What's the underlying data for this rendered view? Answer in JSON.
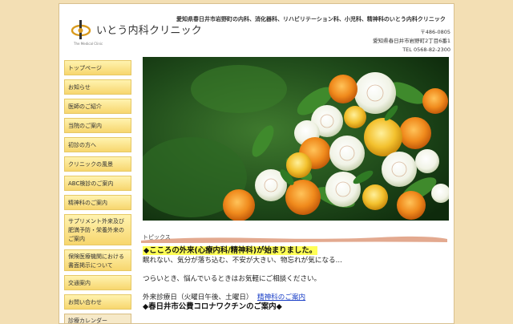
{
  "header": {
    "logo_name": "いとう内科クリニック",
    "logo_tagline_small": "The Medical Clinic",
    "tagline": "愛知県春日井市岩野町の内科、消化器科、リハビリテーション科、小児科、精神科のいとう内科クリニック",
    "postal": "〒486-0805",
    "address": "愛知県春日井市岩野町2丁目6番1",
    "tel": "TEL 0568-82-2300"
  },
  "sidebar": {
    "items": [
      {
        "label": "トップページ"
      },
      {
        "label": "お知らせ"
      },
      {
        "label": "医師のご紹介"
      },
      {
        "label": "当院のご案内"
      },
      {
        "label": "初診の方へ"
      },
      {
        "label": "クリニックの風景"
      },
      {
        "label": "ABC検診のご案内"
      },
      {
        "label": "精神科のご案内"
      },
      {
        "label": "サプリメント外来及び肥満予防・栄養外来のご案内"
      },
      {
        "label": "保険医療機関における書面掲示について"
      },
      {
        "label": "交通案内"
      },
      {
        "label": "お問い合わせ"
      }
    ],
    "calendar_label": "診療カレンダー"
  },
  "topics": {
    "label": "トピックス"
  },
  "content": {
    "headline1": "◆こころの外来(心療内科/精神科)が始まりました。",
    "line1": "眠れない、気分が落ち込む、不安が大きい、物忘れが気になる...",
    "line2": "つらいとき、悩んでいるときはお気軽にご相談ください。",
    "schedule_text": "外来診療日（火曜日午後、土曜日）",
    "schedule_link": "精神科のご案内",
    "headline2": "◆春日井市公費コロナワクチンのご案内◆"
  },
  "colors": {
    "background": "#f3dfb4",
    "nav_gradient_top": "#fff3b0",
    "nav_gradient_bottom": "#f7d66e",
    "highlight": "#ffff55",
    "link": "#1a3fc7"
  }
}
